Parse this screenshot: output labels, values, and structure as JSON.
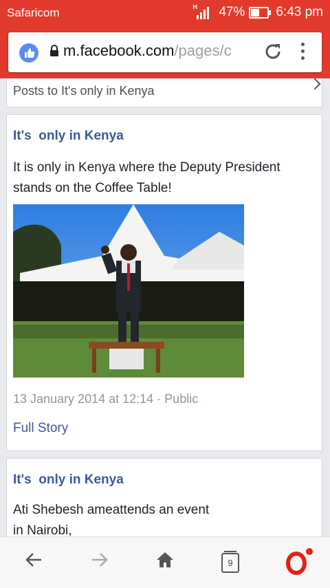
{
  "status_bar": {
    "carrier": "Safaricom",
    "network": "H",
    "battery": "47%",
    "time": "6:43 pm"
  },
  "browser": {
    "url_domain": "m.facebook.com",
    "url_path": "/pages/c",
    "tab_count": "9"
  },
  "page": {
    "posts_header": "Posts to It's  only in Kenya"
  },
  "posts": [
    {
      "author": "It's  only in Kenya",
      "text": "It is only in Kenya where the Deputy President\nstands on the Coffee Table!",
      "timestamp": "13 January 2014 at 12:14",
      "privacy": "Public",
      "full_story": "Full Story"
    },
    {
      "author": "It's  only in Kenya",
      "text": "Ati Shebesh ameattends  an event\nin Nairobi,"
    }
  ],
  "colors": {
    "brand_red": "#e23b2e",
    "facebook_blue": "#3b5998",
    "opera_red": "#e0221c"
  },
  "icons": [
    "signal-icon",
    "battery-icon",
    "like-icon",
    "lock-icon",
    "reload-icon",
    "menu-icon",
    "back-icon",
    "forward-icon",
    "home-icon",
    "tabs-icon",
    "opera-icon",
    "chevron-icon"
  ]
}
